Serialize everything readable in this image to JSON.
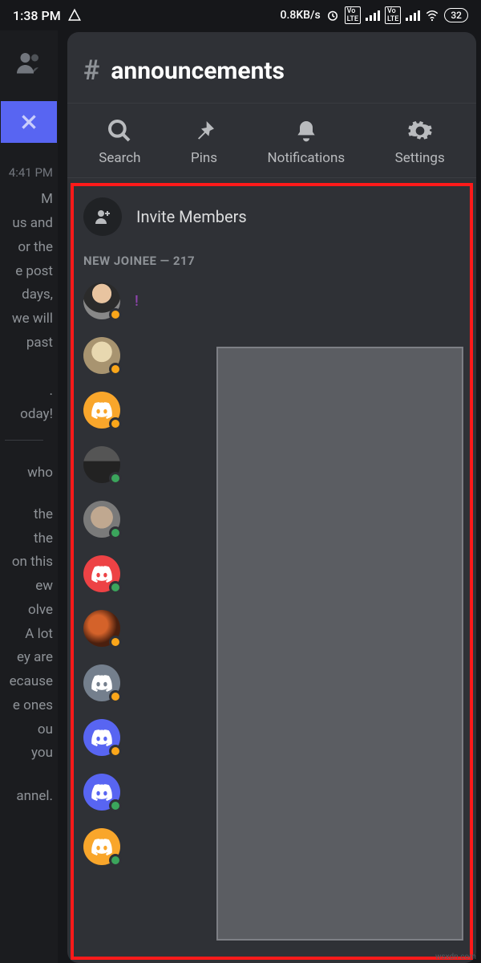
{
  "status_bar": {
    "time": "1:38 PM",
    "net_speed": "0.8KB/s",
    "battery": "32"
  },
  "left_strip": {
    "time1": "4:41 PM",
    "line1": "M",
    "line2": "us and",
    "line3": "or the",
    "line4": "e post",
    "line5": "days,",
    "line6": "we will",
    "line7": "past",
    "line8": "",
    "line9": ".",
    "line10": "oday!",
    "line11": "who",
    "line12": "the",
    "line13": "the",
    "line14": "on this",
    "line15": "ew",
    "line16": "olve",
    "line17": "A lot",
    "line18": "ey are",
    "line19": "ecause",
    "line20": "e ones",
    "line21": "ou",
    "line22": "you",
    "line23": "annel."
  },
  "channel": {
    "name": "announcements"
  },
  "toolbar": {
    "search": "Search",
    "pins": "Pins",
    "notifications": "Notifications",
    "settings": "Settings"
  },
  "invite": {
    "label": "Invite Members"
  },
  "section": {
    "header": "NEW JOINEE — 217"
  },
  "members": [
    {
      "name": "!",
      "color": "#8e44ad",
      "avatar_bg": "#d9c7b0",
      "status": "idle",
      "type": "photo1"
    },
    {
      "name": "",
      "avatar_bg": "#b8a98a",
      "status": "idle",
      "type": "photo2"
    },
    {
      "name": "",
      "avatar_bg": "#f9a62b",
      "status": "idle",
      "type": "discord"
    },
    {
      "name": "",
      "avatar_bg": "#3b3b3b",
      "status": "online",
      "type": "photo3"
    },
    {
      "name": "",
      "avatar_bg": "#9b9b9b",
      "status": "online",
      "type": "photo4"
    },
    {
      "name": "",
      "avatar_bg": "#ed4245",
      "status": "online",
      "type": "discord"
    },
    {
      "name": "",
      "avatar_bg": "#6b2e16",
      "status": "idle",
      "type": "photo5"
    },
    {
      "name": "",
      "avatar_bg": "#747f8d",
      "status": "idle",
      "type": "discord"
    },
    {
      "name": "",
      "avatar_bg": "#5865f2",
      "status": "idle",
      "type": "discord"
    },
    {
      "name": "",
      "avatar_bg": "#5865f2",
      "status": "online",
      "type": "discord"
    },
    {
      "name": "",
      "avatar_bg": "#f9a62b",
      "status": "online",
      "type": "discord"
    }
  ],
  "watermark": "wsxdn.com"
}
